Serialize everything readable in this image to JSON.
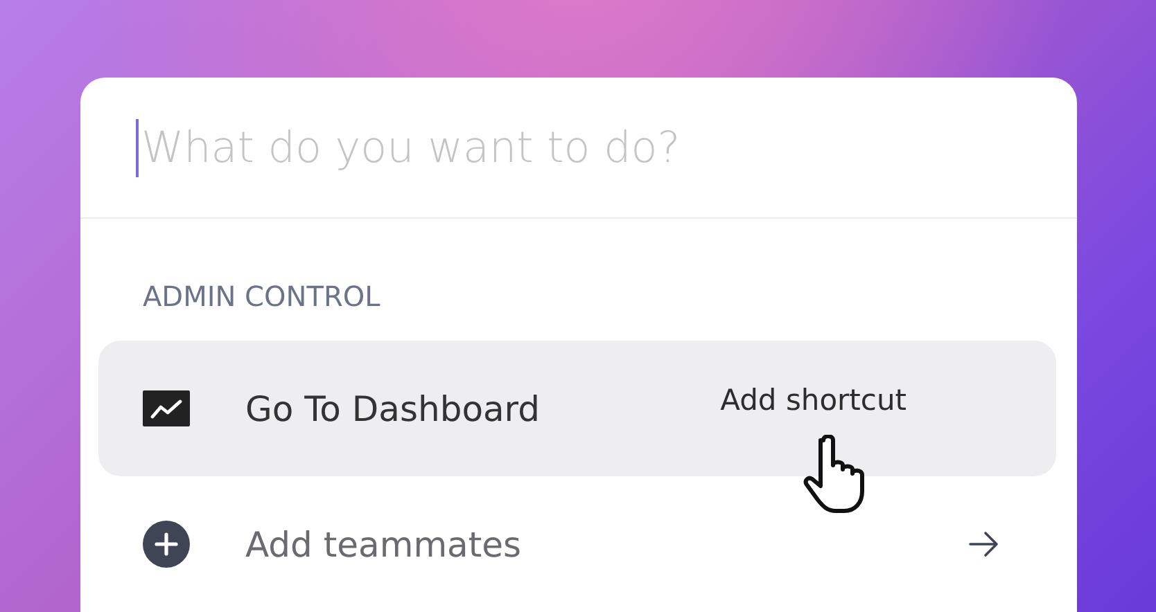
{
  "search": {
    "placeholder": "What do you want to do?"
  },
  "section": {
    "title": "ADMIN CONTROL"
  },
  "items": [
    {
      "kind": "chart",
      "label": "Go To Dashboard",
      "selected": true,
      "hint": "Add shortcut"
    },
    {
      "kind": "add",
      "label": "Add teammates",
      "selected": false
    }
  ]
}
